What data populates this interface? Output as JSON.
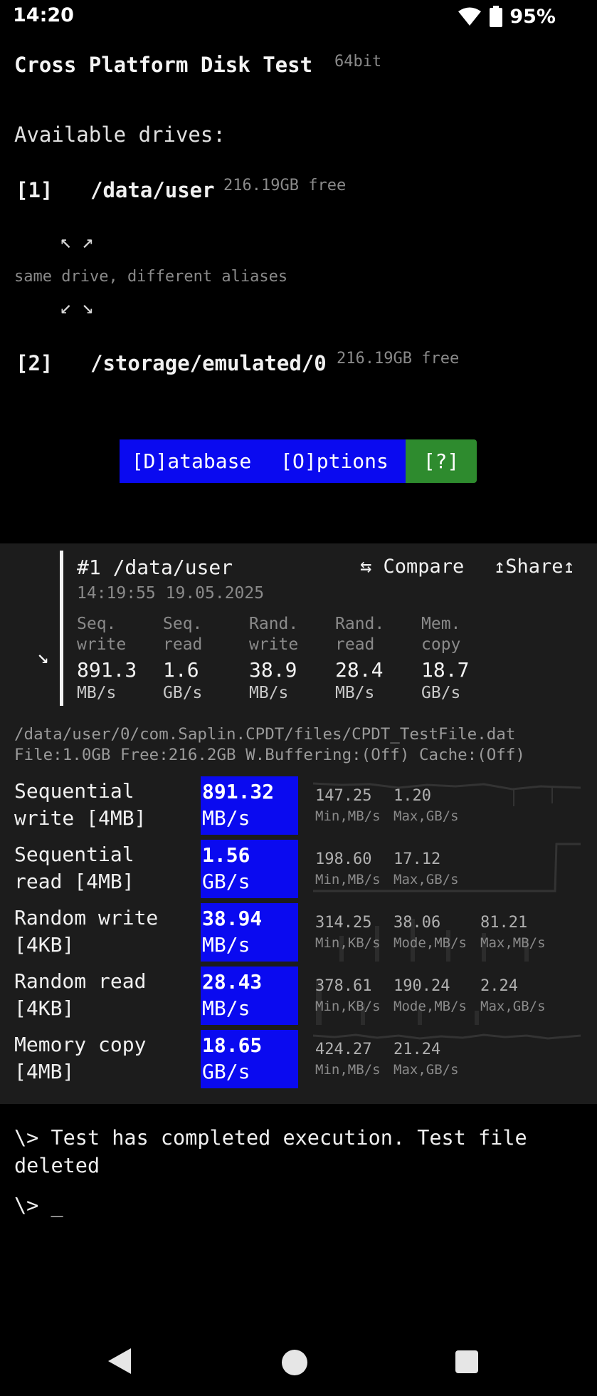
{
  "status_bar": {
    "time": "14:20",
    "battery_percent": "95%",
    "icons": [
      "wifi-icon",
      "battery-icon"
    ]
  },
  "app": {
    "title": "Cross Platform Disk Test",
    "arch": "64bit"
  },
  "drives": {
    "heading": "Available drives:",
    "items": [
      {
        "index": "[1]",
        "path": "/data/user",
        "free": "216.19GB free"
      },
      {
        "index": "[2]",
        "path": "/storage/emulated/0",
        "free": "216.19GB free"
      }
    ],
    "arrows_up": "↖↗",
    "arrows_down": "↙↘",
    "alias_note": "same drive, different aliases"
  },
  "menu": {
    "database": "[D]atabase",
    "options": "[O]ptions",
    "help": "[?]"
  },
  "result": {
    "title": "#1 /data/user",
    "timestamp": "14:19:55 19.05.2025",
    "compare": "⇆ Compare",
    "share": "↥Share↥",
    "collapse_arrow": "↘",
    "summary": [
      {
        "label1": "Seq.",
        "label2": "write",
        "value": "891.3",
        "unit": "MB/s"
      },
      {
        "label1": "Seq.",
        "label2": "read",
        "value": "1.6",
        "unit": "GB/s"
      },
      {
        "label1": "Rand.",
        "label2": "write",
        "value": "38.9",
        "unit": "MB/s"
      },
      {
        "label1": "Rand.",
        "label2": "read",
        "value": "28.4",
        "unit": "MB/s"
      },
      {
        "label1": "Mem.",
        "label2": "copy",
        "value": "18.7",
        "unit": "GB/s"
      }
    ],
    "file_path": "/data/user/0/com.Saplin.CPDT/files/CPDT_TestFile.dat",
    "file_info": "File:1.0GB Free:216.2GB W.Buffering:(Off) Cache:(Off)",
    "tests": [
      {
        "name1": "Sequential",
        "name2": "write [4MB]",
        "value": "891.32",
        "unit": "MB/s",
        "stats": [
          {
            "v": "147.25",
            "l": "Min,MB/s"
          },
          {
            "v": "1.20",
            "l": "Max,GB/s"
          }
        ]
      },
      {
        "name1": "Sequential",
        "name2": "read [4MB]",
        "value": "1.56",
        "unit": "GB/s",
        "stats": [
          {
            "v": "198.60",
            "l": "Min,MB/s"
          },
          {
            "v": "17.12",
            "l": "Max,GB/s"
          }
        ]
      },
      {
        "name1": "Random write",
        "name2": "[4KB]",
        "value": "38.94",
        "unit": "MB/s",
        "stats": [
          {
            "v": "314.25",
            "l": "Min,KB/s"
          },
          {
            "v": "38.06",
            "l": "Mode,MB/s"
          },
          {
            "v": "81.21",
            "l": "Max,MB/s"
          }
        ]
      },
      {
        "name1": "Random read",
        "name2": "[4KB]",
        "value": "28.43",
        "unit": "MB/s",
        "stats": [
          {
            "v": "378.61",
            "l": "Min,KB/s"
          },
          {
            "v": "190.24",
            "l": "Mode,MB/s"
          },
          {
            "v": "2.24",
            "l": "Max,GB/s"
          }
        ]
      },
      {
        "name1": "Memory copy",
        "name2": "[4MB]",
        "value": "18.65",
        "unit": "GB/s",
        "stats": [
          {
            "v": "424.27",
            "l": "Min,MB/s"
          },
          {
            "v": "21.24",
            "l": "Max,GB/s"
          }
        ]
      }
    ]
  },
  "console": {
    "message": "\\> Test has completed execution. Test file deleted",
    "prompt": "\\> _"
  },
  "colors": {
    "accent_blue": "#0a0af0",
    "help_green": "#2e8b2e",
    "panel_bg": "#1c1c1c"
  }
}
